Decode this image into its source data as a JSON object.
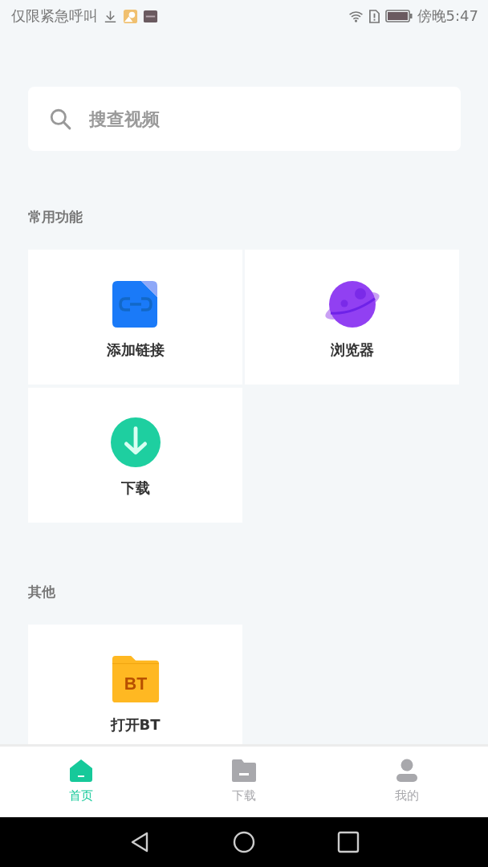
{
  "status_bar": {
    "notification": "仅限紧急呼叫",
    "time": "傍晚5:47"
  },
  "search": {
    "placeholder": "搜查视频"
  },
  "sections": [
    {
      "title": "常用功能",
      "items": [
        {
          "label": "添加链接",
          "kind": "link"
        },
        {
          "label": "浏览器",
          "kind": "planet"
        },
        {
          "label": "下载",
          "kind": "download"
        }
      ]
    },
    {
      "title": "其他",
      "items": [
        {
          "label": "打开BT",
          "kind": "bt",
          "icon_text": "BT"
        }
      ]
    }
  ],
  "bottom_nav": [
    {
      "label": "首页",
      "kind": "home",
      "selected": true
    },
    {
      "label": "下载",
      "kind": "folder",
      "selected": false
    },
    {
      "label": "我的",
      "kind": "person",
      "selected": false
    }
  ]
}
